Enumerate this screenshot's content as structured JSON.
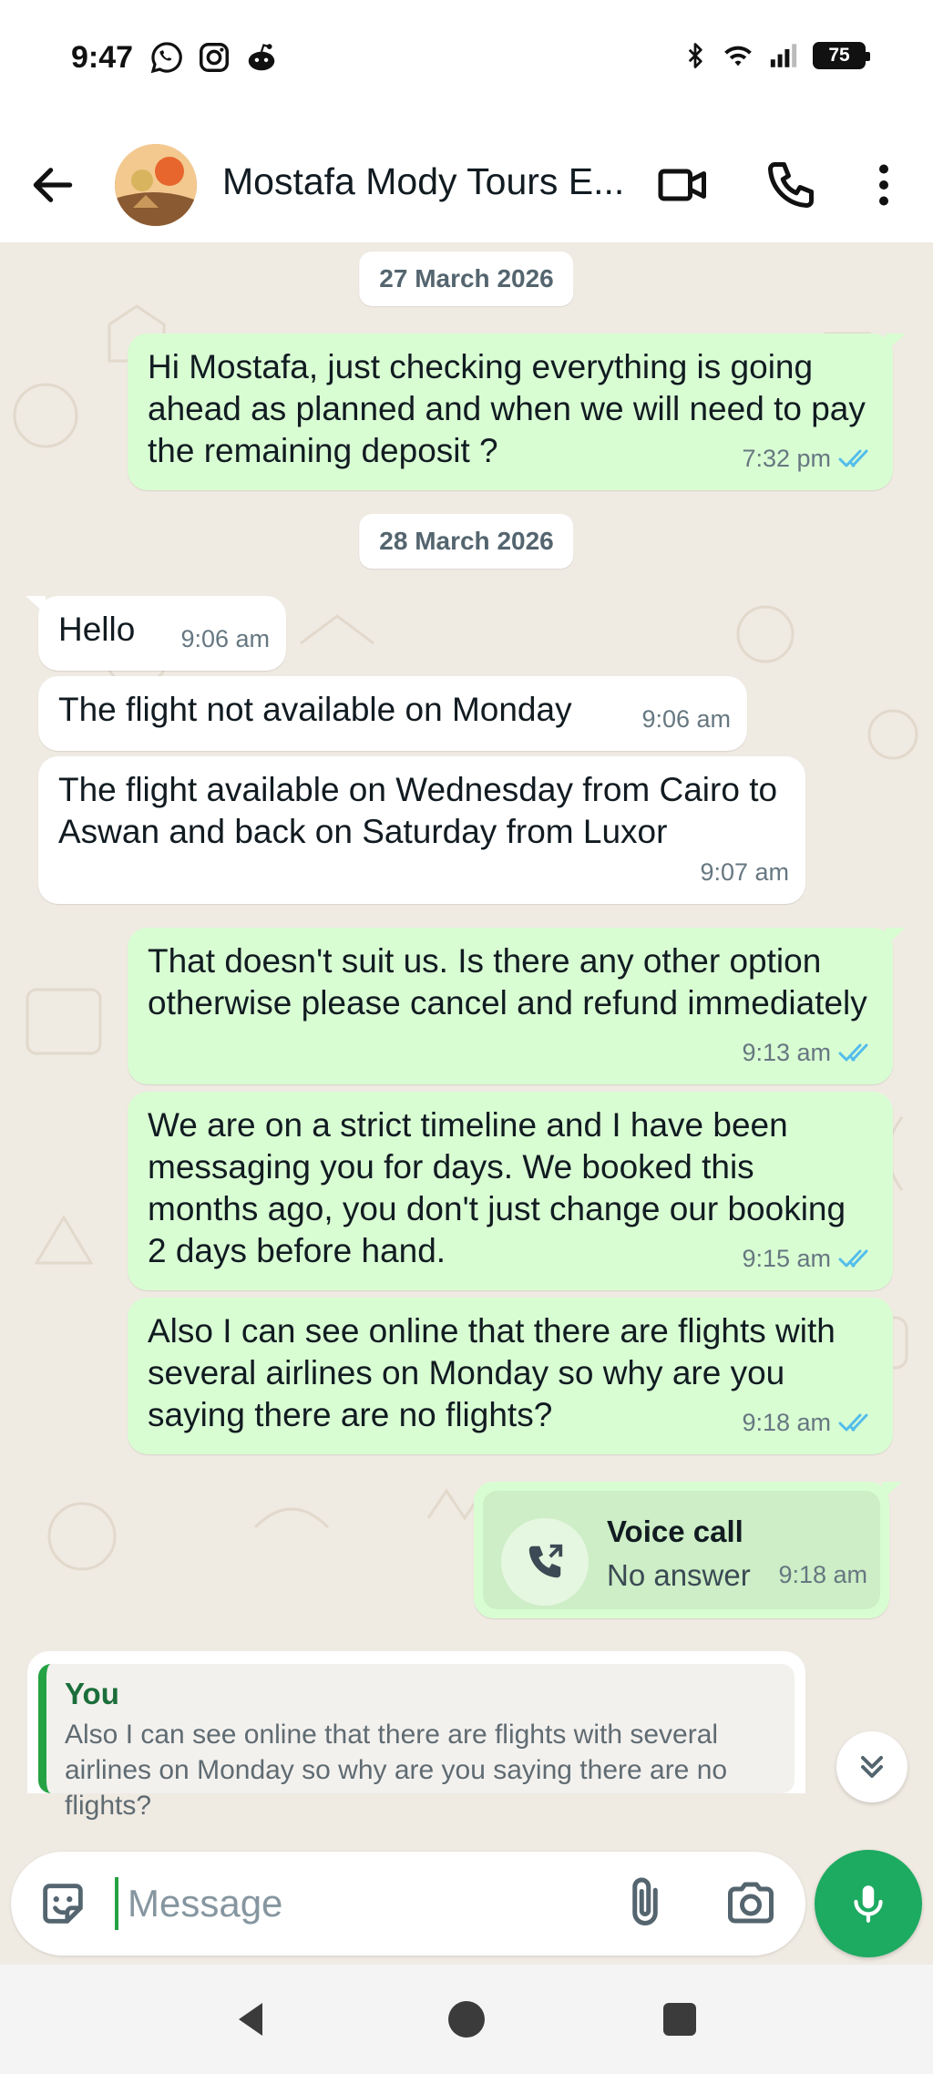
{
  "status_bar": {
    "time": "9:47",
    "battery": "75",
    "left_icons": [
      "whatsapp-icon",
      "instagram-icon",
      "reddit-icon"
    ],
    "right_icons": [
      "bluetooth-icon",
      "wifi-icon",
      "signal-icon",
      "battery-icon"
    ]
  },
  "header": {
    "contact_name": "Mostafa Mody Tours E...",
    "icons": [
      "back-arrow-icon",
      "avatar",
      "video-call-icon",
      "phone-icon",
      "more-vert-icon"
    ]
  },
  "messages": {
    "date_1": "27 March 2026",
    "date_2": "28 March 2026",
    "m1": {
      "text": "Hi Mostafa, just checking everything is going ahead as planned and when we will need to pay the remaining deposit ?",
      "time": "7:32 pm"
    },
    "m2": {
      "text": "Hello",
      "time": "9:06 am"
    },
    "m3": {
      "text": "The flight not available on Monday",
      "time": "9:06 am"
    },
    "m4": {
      "text": "The flight available on Wednesday from Cairo to Aswan and back on Saturday from Luxor",
      "time": "9:07 am"
    },
    "m5": {
      "text": "That doesn't suit us. Is there any other option otherwise please cancel and refund immediately",
      "time": "9:13 am"
    },
    "m6": {
      "text": "We are on a strict timeline and I have been messaging you for days. We booked this months ago, you don't just change our booking 2 days before hand.",
      "time": "9:15 am"
    },
    "m7": {
      "text": "Also I can see online that there are flights with several airlines on Monday so why are you saying there are no flights?",
      "time": "9:18 am"
    },
    "call": {
      "title": "Voice call",
      "status": "No answer",
      "time": "9:18 am"
    }
  },
  "reply": {
    "author": "You",
    "text": "Also I can see online that there are flights with several airlines on Monday so why are you saying there are no flights?"
  },
  "composer": {
    "placeholder": "Message"
  },
  "colors": {
    "outgoing_bubble": "#d9fdd3",
    "incoming_bubble": "#ffffff",
    "chat_background": "#efeae2",
    "accent_green": "#1daa61",
    "read_ticks": "#53bdeb"
  }
}
